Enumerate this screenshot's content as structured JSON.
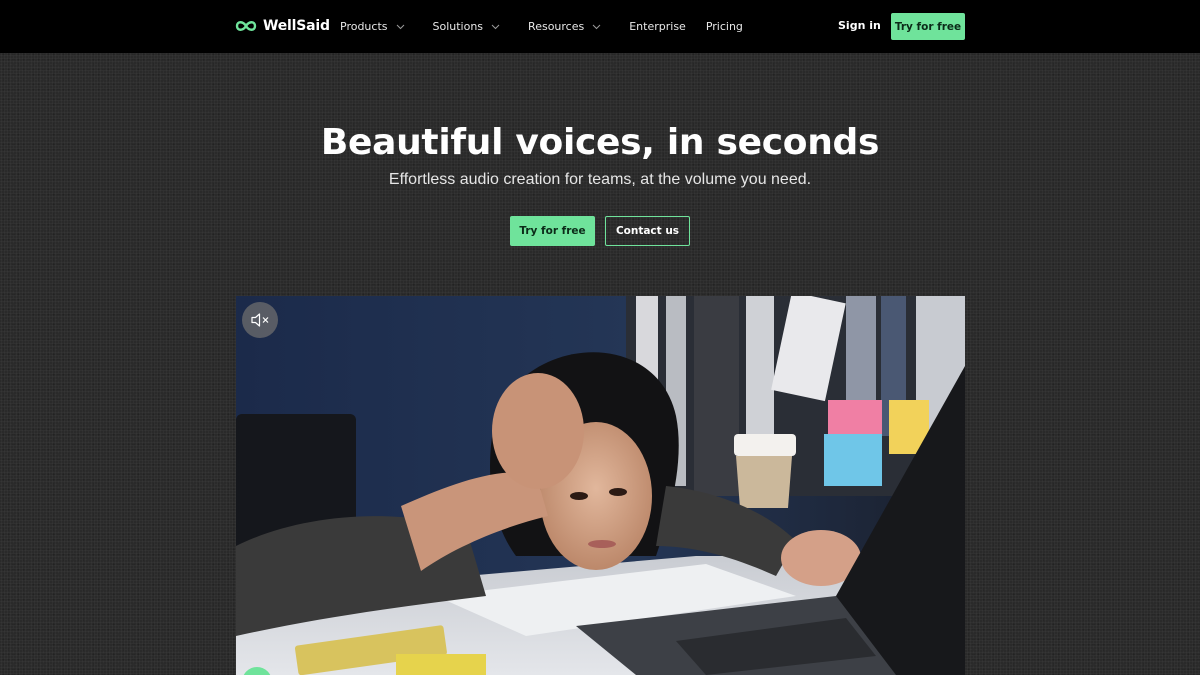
{
  "brand": {
    "name": "WellSaid",
    "accent": "#6fe39b",
    "logo_icon": "infinity-wave-logo"
  },
  "nav": {
    "items": [
      {
        "label": "Products",
        "has_dropdown": true
      },
      {
        "label": "Solutions",
        "has_dropdown": true
      },
      {
        "label": "Resources",
        "has_dropdown": true
      },
      {
        "label": "Enterprise",
        "has_dropdown": false
      },
      {
        "label": "Pricing",
        "has_dropdown": false
      }
    ],
    "sign_in": "Sign in",
    "cta": "Try for free"
  },
  "hero": {
    "title": "Beautiful voices, in seconds",
    "subtitle": "Effortless audio creation for teams, at the volume you need.",
    "primary_cta": "Try for free",
    "secondary_cta": "Contact us"
  },
  "video": {
    "muted": true,
    "mute_icon": "speaker-muted-icon"
  }
}
